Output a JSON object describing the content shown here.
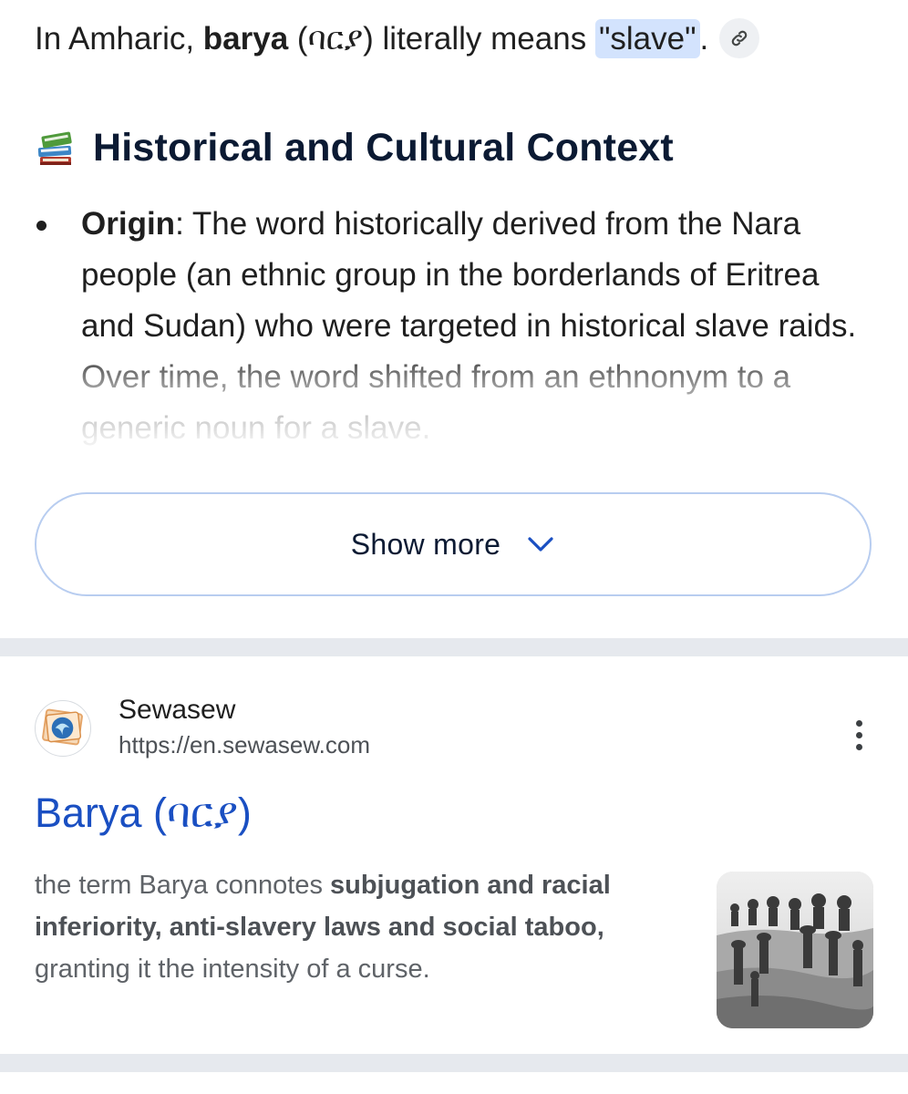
{
  "intro": {
    "prefix": "In Amharic, ",
    "term": "barya",
    "script": " (ባርያ) literally means ",
    "meaning": "\"slave\"",
    "suffix": "."
  },
  "section": {
    "emoji_icon": "books-icon",
    "heading": "Historical and Cultural Context"
  },
  "bullet": {
    "label": "Origin",
    "colon": ":",
    "text": " The word historically derived from the Nara people (an ethnic group in the borderlands of Eritrea and Sudan) who were targeted in historical slave raids. Over time, the word shifted from an ethnonym to a generic noun for a slave."
  },
  "show_more": {
    "label": "Show more",
    "icon": "chevron-down-icon"
  },
  "result": {
    "site_name": "Sewasew",
    "url": "https://en.sewasew.com",
    "title": "Barya (ባርያ)",
    "snippet_plain_1": "the term Barya connotes ",
    "snippet_bold": "subjugation and racial inferiority, anti-slavery laws and social taboo,",
    "snippet_plain_2": " granting it the intensity of a curse.",
    "menu_icon": "more-vert-icon"
  },
  "colors": {
    "link_blue": "#1a4fc2",
    "heading_navy": "#0b1a33",
    "highlight": "#d3e3fd",
    "divider": "#e6e9ee"
  }
}
